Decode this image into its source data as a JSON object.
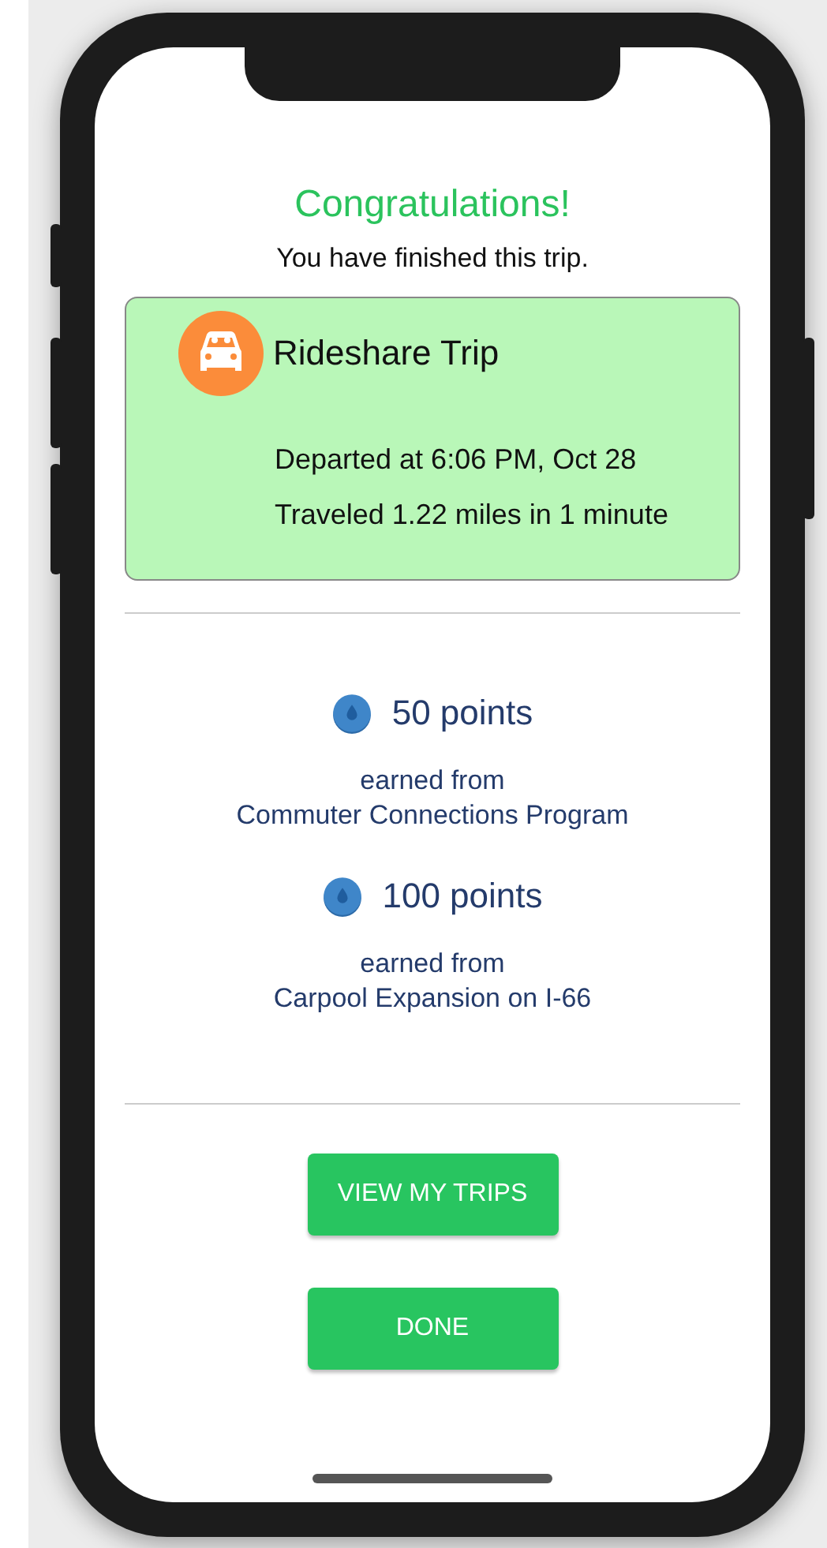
{
  "title": "Congratulations!",
  "subtitle": "You have finished this trip.",
  "trip": {
    "title": "Rideshare Trip",
    "departed": "Departed at 6:06 PM, Oct 28",
    "traveled": "Traveled 1.22 miles in 1 minute"
  },
  "rewards": [
    {
      "points": "50 points",
      "earned_label": "earned from",
      "source": "Commuter Connections Program"
    },
    {
      "points": "100 points",
      "earned_label": "earned from",
      "source": "Carpool Expansion on I-66"
    }
  ],
  "buttons": [
    {
      "label": "VIEW MY TRIPS"
    },
    {
      "label": "DONE"
    }
  ]
}
